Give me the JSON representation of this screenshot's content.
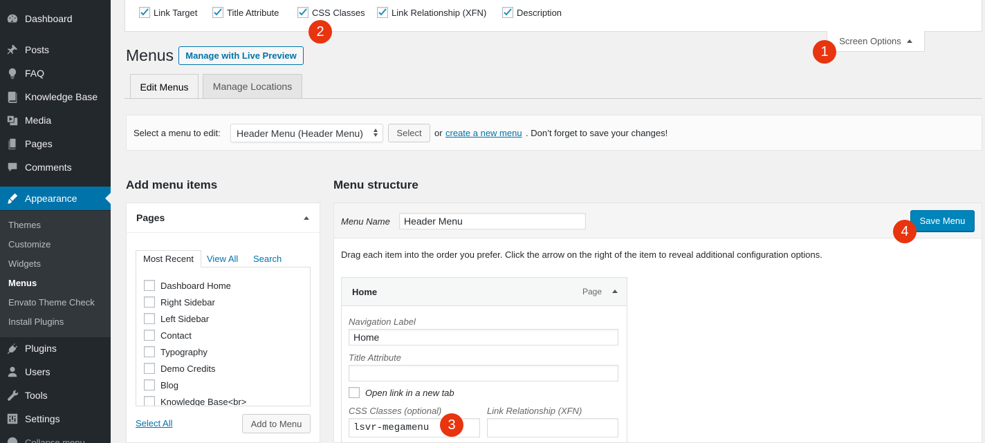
{
  "sidebar": {
    "items": [
      {
        "label": "Dashboard",
        "icon": "dashboard-icon"
      },
      {
        "label": "Posts",
        "icon": "pin-icon"
      },
      {
        "label": "FAQ",
        "icon": "lightbulb-icon"
      },
      {
        "label": "Knowledge Base",
        "icon": "book-icon"
      },
      {
        "label": "Media",
        "icon": "media-icon"
      },
      {
        "label": "Pages",
        "icon": "page-icon"
      },
      {
        "label": "Comments",
        "icon": "comment-icon"
      },
      {
        "label": "Appearance",
        "icon": "brush-icon"
      },
      {
        "label": "Plugins",
        "icon": "plug-icon"
      },
      {
        "label": "Users",
        "icon": "user-icon"
      },
      {
        "label": "Tools",
        "icon": "wrench-icon"
      },
      {
        "label": "Settings",
        "icon": "settings-icon"
      },
      {
        "label": "Collapse menu",
        "icon": "collapse-icon"
      }
    ],
    "submenu": [
      "Themes",
      "Customize",
      "Widgets",
      "Menus",
      "Envato Theme Check",
      "Install Plugins"
    ],
    "active_color": "#0073aa"
  },
  "screen_options": {
    "checks": [
      "Link Target",
      "Title Attribute",
      "CSS Classes",
      "Link Relationship (XFN)",
      "Description"
    ],
    "tab_label": "Screen Options"
  },
  "badges": [
    "1",
    "2",
    "3",
    "4"
  ],
  "header": {
    "title": "Menus",
    "live_preview": "Manage with Live Preview"
  },
  "tabs": [
    "Edit Menus",
    "Manage Locations"
  ],
  "manage": {
    "label": "Select a menu to edit:",
    "selected": "Header Menu (Header Menu)",
    "select_btn": "Select",
    "or": "or",
    "create_link": "create a new menu",
    "rest": ". Don’t forget to save your changes!"
  },
  "add_items": {
    "heading": "Add menu items",
    "box_title": "Pages",
    "tabs": [
      "Most Recent",
      "View All",
      "Search"
    ],
    "pages": [
      "Dashboard Home",
      "Right Sidebar",
      "Left Sidebar",
      "Contact",
      "Typography",
      "Demo Credits",
      "Blog",
      "Knowledge Base<br>"
    ],
    "select_all": "Select All",
    "add_button": "Add to Menu"
  },
  "structure": {
    "heading": "Menu structure",
    "name_label": "Menu Name",
    "name_value": "Header Menu",
    "save": "Save Menu",
    "hint": "Drag each item into the order you prefer. Click the arrow on the right of the item to reveal additional configuration options.",
    "item": {
      "title": "Home",
      "type": "Page",
      "nav_label": "Navigation Label",
      "nav_value": "Home",
      "title_attr_label": "Title Attribute",
      "title_attr_value": "",
      "new_tab_label": "Open link in a new tab",
      "css_label": "CSS Classes (optional)",
      "css_value": "lsvr-megamenu",
      "xfn_label": "Link Relationship (XFN)",
      "xfn_value": ""
    }
  }
}
